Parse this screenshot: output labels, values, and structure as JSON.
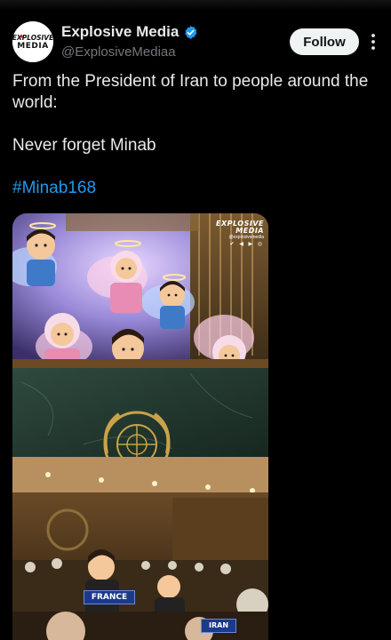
{
  "post": {
    "author": {
      "display_name": "Explosive Media",
      "handle": "@ExplosiveMediaa",
      "avatar_text_line1": "EXPLOSIVE",
      "avatar_text_line2": "MEDIA",
      "verified": true
    },
    "follow_label": "Follow",
    "text_paragraphs": [
      "From the President of Iran to people around the world:",
      "Never forget Minab"
    ],
    "hashtag": "#Minab168",
    "media": {
      "watermark_logo_line1": "EXPLOSIVE",
      "watermark_logo_line2": "MEDIA",
      "watermark_handle": "@explosivemedia",
      "watermark_icons": "✔ ◀ ▶ ◎",
      "nameplates": [
        "FRANCE",
        "IRAN"
      ]
    }
  },
  "colors": {
    "background": "#000000",
    "text": "#e7e9ea",
    "secondary_text": "#71767b",
    "link": "#1d9bf0",
    "follow_bg": "#eff3f4",
    "verified": "#1d9bf0"
  }
}
